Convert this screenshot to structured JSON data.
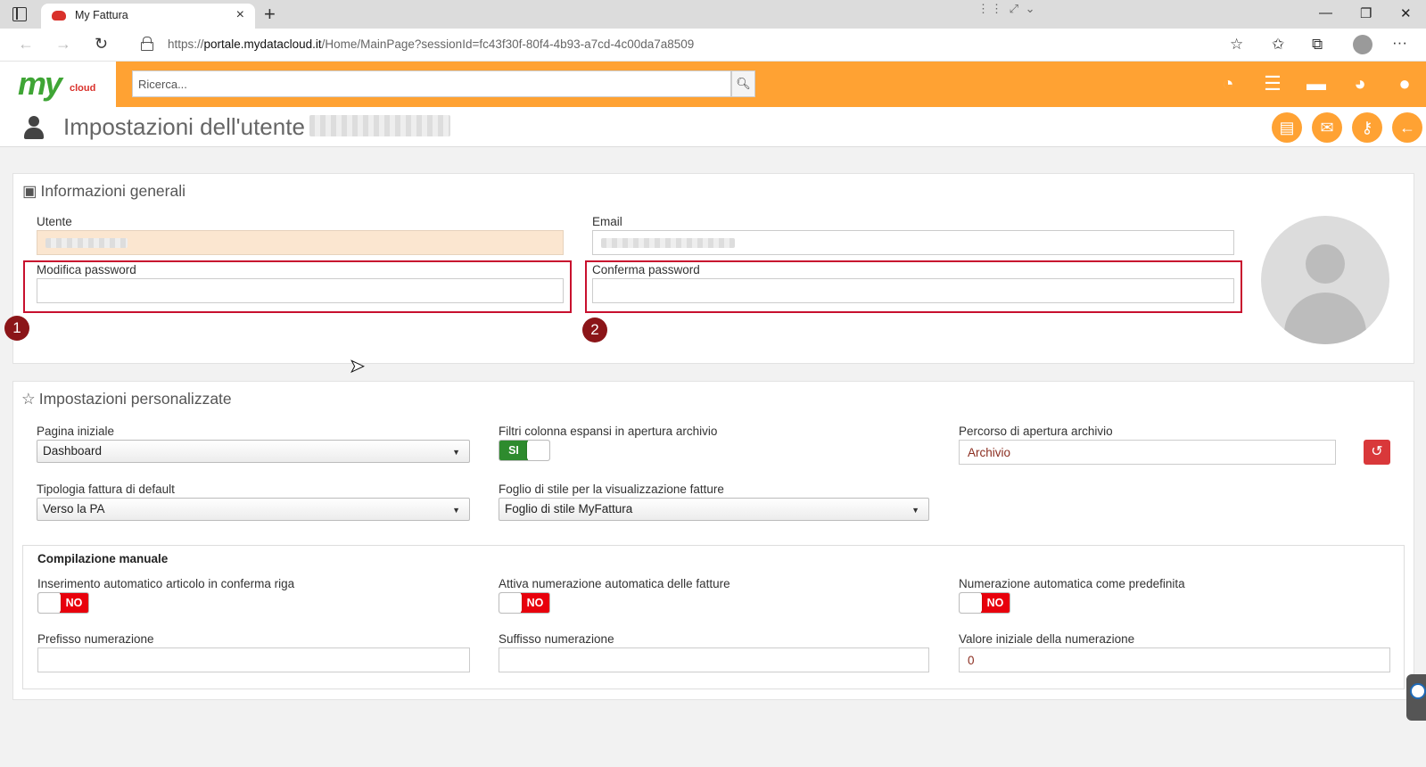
{
  "browser": {
    "tab_title": "My Fattura",
    "tab_close_icon": "×",
    "new_tab_icon": "+",
    "url_prefix": "https://",
    "url_host": "portale.mydatacloud.it",
    "url_path": "/Home/MainPage?sessionId=fc43f30f-80f4-4b93-a7cd-4c00da7a8509",
    "back_icon": "←",
    "forward_icon": "→",
    "refresh_icon": "↻",
    "minimize_icon": "—",
    "restore_icon": "❐",
    "close_icon": "✕",
    "favorites_add_icon": "☆",
    "favorites_icon": "✩",
    "collections_icon": "⧉",
    "more_icon": "···",
    "extra_icon": "⋮⋮ ⤢ ⌄"
  },
  "header": {
    "logo_main": "my",
    "logo_sub": "cloud",
    "search_placeholder": "Ricerca...",
    "search_icon": "🔍︎",
    "icons": [
      {
        "name": "dashboard-icon",
        "glyph": "◔"
      },
      {
        "name": "list-icon",
        "glyph": "☰"
      },
      {
        "name": "briefcase-icon",
        "glyph": "▬"
      },
      {
        "name": "pie-chart-icon",
        "glyph": "◕"
      },
      {
        "name": "user-icon",
        "glyph": "●"
      }
    ]
  },
  "page": {
    "title": "Impostazioni dell'utente",
    "actions": [
      {
        "name": "id-card-icon",
        "glyph": "▤"
      },
      {
        "name": "mail-icon",
        "glyph": "✉"
      },
      {
        "name": "key-icon",
        "glyph": "⚷"
      },
      {
        "name": "back-arrow-icon",
        "glyph": "←"
      }
    ]
  },
  "general": {
    "title": "Informazioni generali",
    "title_icon": "▣",
    "user_label": "Utente",
    "email_label": "Email",
    "password_label": "Modifica password",
    "confirm_label": "Conferma password",
    "marker_1": "1",
    "marker_2": "2"
  },
  "custom": {
    "title": "Impostazioni personalizzate",
    "title_icon": "☆",
    "home_label": "Pagina iniziale",
    "home_value": "Dashboard",
    "filters_label": "Filtri colonna espansi in apertura archivio",
    "filters_value": "SI",
    "archive_path_label": "Percorso di apertura archivio",
    "archive_path_value": "Archivio",
    "reset_icon": "↺",
    "invoice_type_label": "Tipologia fattura di default",
    "invoice_type_value": "Verso la PA",
    "stylesheet_label": "Foglio di stile per la visualizzazione fatture",
    "stylesheet_value": "Foglio di stile MyFattura",
    "select_arrow": "▼"
  },
  "manual": {
    "title": "Compilazione manuale",
    "auto_insert_label": "Inserimento automatico articolo in conferma riga",
    "auto_insert_value": "NO",
    "auto_numbering_label": "Attiva numerazione automatica delle fatture",
    "auto_numbering_value": "NO",
    "default_numbering_label": "Numerazione automatica come predefinita",
    "default_numbering_value": "NO",
    "prefix_label": "Prefisso numerazione",
    "prefix_value": "",
    "suffix_label": "Suffisso numerazione",
    "suffix_value": "",
    "start_value_label": "Valore iniziale della numerazione",
    "start_value": "0"
  }
}
